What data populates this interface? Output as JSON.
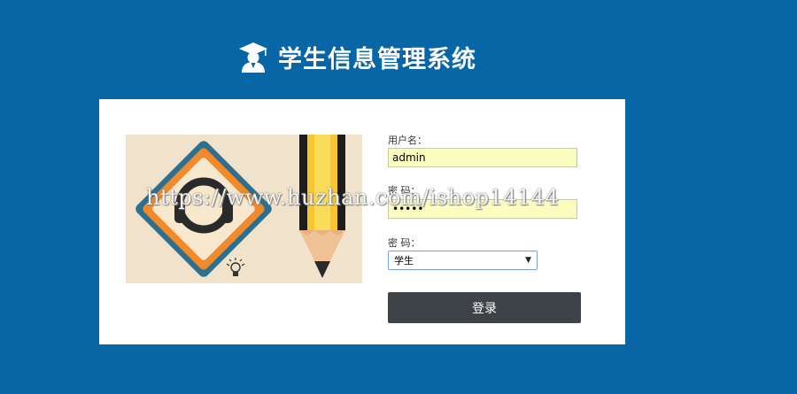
{
  "header": {
    "title": "学生信息管理系统",
    "logo_icon": "student-graduate-icon"
  },
  "form": {
    "username_label": "用户名：",
    "username_value": "admin",
    "password_label": "密 码：",
    "password_value": "•••••",
    "role_label": "密 码：",
    "role_selected": "学生",
    "login_label": "登录"
  },
  "illustration": {
    "icon": "headset-pencil-illustration",
    "bulb_icon": "lightbulb-icon"
  },
  "watermark": {
    "text": "https://www.huzhan.com/ishop14144"
  },
  "colors": {
    "background": "#0865a6",
    "panel": "#ffffff",
    "input_fill": "#fbfcc0",
    "button": "#3e4348"
  }
}
